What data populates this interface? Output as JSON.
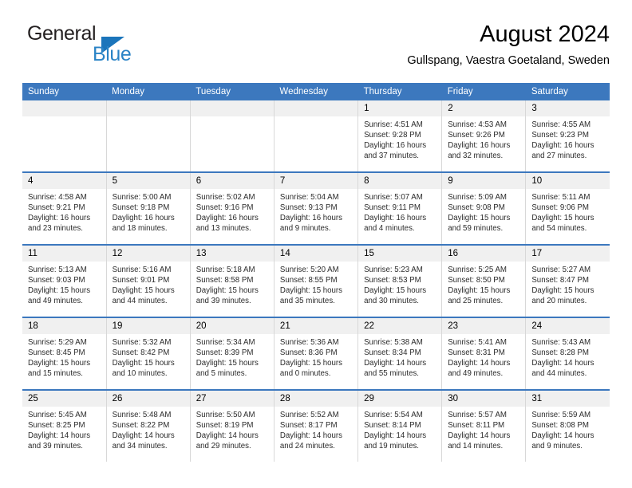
{
  "brand": {
    "name_top": "General",
    "name_bottom": "Blue",
    "triangle_color": "#1b75bb",
    "blue_color": "#2a83c6"
  },
  "header": {
    "title": "August 2024",
    "subtitle": "Gullspang, Vaestra Goetaland, Sweden"
  },
  "theme": {
    "header_blue": "#3c78be",
    "daynum_band": "#f0f0f0",
    "cell_border": "#d8d8d8"
  },
  "weekdays": [
    "Sunday",
    "Monday",
    "Tuesday",
    "Wednesday",
    "Thursday",
    "Friday",
    "Saturday"
  ],
  "weeks": [
    [
      {
        "day": "",
        "sunrise": "",
        "sunset": "",
        "daylight_line1": "",
        "daylight_line2": ""
      },
      {
        "day": "",
        "sunrise": "",
        "sunset": "",
        "daylight_line1": "",
        "daylight_line2": ""
      },
      {
        "day": "",
        "sunrise": "",
        "sunset": "",
        "daylight_line1": "",
        "daylight_line2": ""
      },
      {
        "day": "",
        "sunrise": "",
        "sunset": "",
        "daylight_line1": "",
        "daylight_line2": ""
      },
      {
        "day": "1",
        "sunrise": "Sunrise: 4:51 AM",
        "sunset": "Sunset: 9:28 PM",
        "daylight_line1": "Daylight: 16 hours",
        "daylight_line2": "and 37 minutes."
      },
      {
        "day": "2",
        "sunrise": "Sunrise: 4:53 AM",
        "sunset": "Sunset: 9:26 PM",
        "daylight_line1": "Daylight: 16 hours",
        "daylight_line2": "and 32 minutes."
      },
      {
        "day": "3",
        "sunrise": "Sunrise: 4:55 AM",
        "sunset": "Sunset: 9:23 PM",
        "daylight_line1": "Daylight: 16 hours",
        "daylight_line2": "and 27 minutes."
      }
    ],
    [
      {
        "day": "4",
        "sunrise": "Sunrise: 4:58 AM",
        "sunset": "Sunset: 9:21 PM",
        "daylight_line1": "Daylight: 16 hours",
        "daylight_line2": "and 23 minutes."
      },
      {
        "day": "5",
        "sunrise": "Sunrise: 5:00 AM",
        "sunset": "Sunset: 9:18 PM",
        "daylight_line1": "Daylight: 16 hours",
        "daylight_line2": "and 18 minutes."
      },
      {
        "day": "6",
        "sunrise": "Sunrise: 5:02 AM",
        "sunset": "Sunset: 9:16 PM",
        "daylight_line1": "Daylight: 16 hours",
        "daylight_line2": "and 13 minutes."
      },
      {
        "day": "7",
        "sunrise": "Sunrise: 5:04 AM",
        "sunset": "Sunset: 9:13 PM",
        "daylight_line1": "Daylight: 16 hours",
        "daylight_line2": "and 9 minutes."
      },
      {
        "day": "8",
        "sunrise": "Sunrise: 5:07 AM",
        "sunset": "Sunset: 9:11 PM",
        "daylight_line1": "Daylight: 16 hours",
        "daylight_line2": "and 4 minutes."
      },
      {
        "day": "9",
        "sunrise": "Sunrise: 5:09 AM",
        "sunset": "Sunset: 9:08 PM",
        "daylight_line1": "Daylight: 15 hours",
        "daylight_line2": "and 59 minutes."
      },
      {
        "day": "10",
        "sunrise": "Sunrise: 5:11 AM",
        "sunset": "Sunset: 9:06 PM",
        "daylight_line1": "Daylight: 15 hours",
        "daylight_line2": "and 54 minutes."
      }
    ],
    [
      {
        "day": "11",
        "sunrise": "Sunrise: 5:13 AM",
        "sunset": "Sunset: 9:03 PM",
        "daylight_line1": "Daylight: 15 hours",
        "daylight_line2": "and 49 minutes."
      },
      {
        "day": "12",
        "sunrise": "Sunrise: 5:16 AM",
        "sunset": "Sunset: 9:01 PM",
        "daylight_line1": "Daylight: 15 hours",
        "daylight_line2": "and 44 minutes."
      },
      {
        "day": "13",
        "sunrise": "Sunrise: 5:18 AM",
        "sunset": "Sunset: 8:58 PM",
        "daylight_line1": "Daylight: 15 hours",
        "daylight_line2": "and 39 minutes."
      },
      {
        "day": "14",
        "sunrise": "Sunrise: 5:20 AM",
        "sunset": "Sunset: 8:55 PM",
        "daylight_line1": "Daylight: 15 hours",
        "daylight_line2": "and 35 minutes."
      },
      {
        "day": "15",
        "sunrise": "Sunrise: 5:23 AM",
        "sunset": "Sunset: 8:53 PM",
        "daylight_line1": "Daylight: 15 hours",
        "daylight_line2": "and 30 minutes."
      },
      {
        "day": "16",
        "sunrise": "Sunrise: 5:25 AM",
        "sunset": "Sunset: 8:50 PM",
        "daylight_line1": "Daylight: 15 hours",
        "daylight_line2": "and 25 minutes."
      },
      {
        "day": "17",
        "sunrise": "Sunrise: 5:27 AM",
        "sunset": "Sunset: 8:47 PM",
        "daylight_line1": "Daylight: 15 hours",
        "daylight_line2": "and 20 minutes."
      }
    ],
    [
      {
        "day": "18",
        "sunrise": "Sunrise: 5:29 AM",
        "sunset": "Sunset: 8:45 PM",
        "daylight_line1": "Daylight: 15 hours",
        "daylight_line2": "and 15 minutes."
      },
      {
        "day": "19",
        "sunrise": "Sunrise: 5:32 AM",
        "sunset": "Sunset: 8:42 PM",
        "daylight_line1": "Daylight: 15 hours",
        "daylight_line2": "and 10 minutes."
      },
      {
        "day": "20",
        "sunrise": "Sunrise: 5:34 AM",
        "sunset": "Sunset: 8:39 PM",
        "daylight_line1": "Daylight: 15 hours",
        "daylight_line2": "and 5 minutes."
      },
      {
        "day": "21",
        "sunrise": "Sunrise: 5:36 AM",
        "sunset": "Sunset: 8:36 PM",
        "daylight_line1": "Daylight: 15 hours",
        "daylight_line2": "and 0 minutes."
      },
      {
        "day": "22",
        "sunrise": "Sunrise: 5:38 AM",
        "sunset": "Sunset: 8:34 PM",
        "daylight_line1": "Daylight: 14 hours",
        "daylight_line2": "and 55 minutes."
      },
      {
        "day": "23",
        "sunrise": "Sunrise: 5:41 AM",
        "sunset": "Sunset: 8:31 PM",
        "daylight_line1": "Daylight: 14 hours",
        "daylight_line2": "and 49 minutes."
      },
      {
        "day": "24",
        "sunrise": "Sunrise: 5:43 AM",
        "sunset": "Sunset: 8:28 PM",
        "daylight_line1": "Daylight: 14 hours",
        "daylight_line2": "and 44 minutes."
      }
    ],
    [
      {
        "day": "25",
        "sunrise": "Sunrise: 5:45 AM",
        "sunset": "Sunset: 8:25 PM",
        "daylight_line1": "Daylight: 14 hours",
        "daylight_line2": "and 39 minutes."
      },
      {
        "day": "26",
        "sunrise": "Sunrise: 5:48 AM",
        "sunset": "Sunset: 8:22 PM",
        "daylight_line1": "Daylight: 14 hours",
        "daylight_line2": "and 34 minutes."
      },
      {
        "day": "27",
        "sunrise": "Sunrise: 5:50 AM",
        "sunset": "Sunset: 8:19 PM",
        "daylight_line1": "Daylight: 14 hours",
        "daylight_line2": "and 29 minutes."
      },
      {
        "day": "28",
        "sunrise": "Sunrise: 5:52 AM",
        "sunset": "Sunset: 8:17 PM",
        "daylight_line1": "Daylight: 14 hours",
        "daylight_line2": "and 24 minutes."
      },
      {
        "day": "29",
        "sunrise": "Sunrise: 5:54 AM",
        "sunset": "Sunset: 8:14 PM",
        "daylight_line1": "Daylight: 14 hours",
        "daylight_line2": "and 19 minutes."
      },
      {
        "day": "30",
        "sunrise": "Sunrise: 5:57 AM",
        "sunset": "Sunset: 8:11 PM",
        "daylight_line1": "Daylight: 14 hours",
        "daylight_line2": "and 14 minutes."
      },
      {
        "day": "31",
        "sunrise": "Sunrise: 5:59 AM",
        "sunset": "Sunset: 8:08 PM",
        "daylight_line1": "Daylight: 14 hours",
        "daylight_line2": "and 9 minutes."
      }
    ]
  ]
}
